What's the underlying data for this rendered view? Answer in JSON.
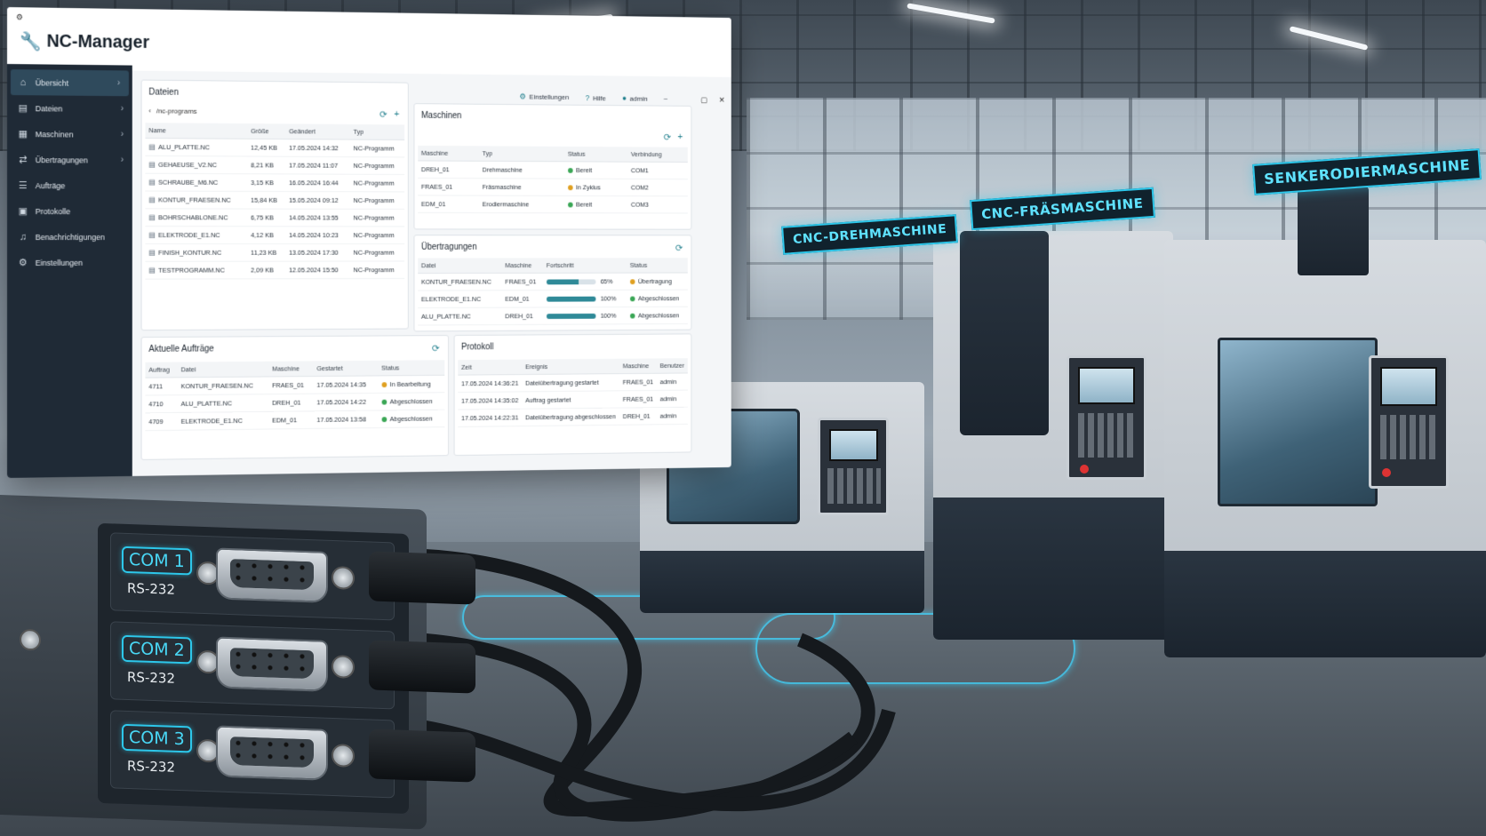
{
  "app": {
    "title": "NC-Manager",
    "accent": "#1e7e8c",
    "sidebar_bg": "#1f2a36"
  },
  "toolbar": {
    "settings": "Einstellungen",
    "help": "Hilfe",
    "user": "admin"
  },
  "sidebar": {
    "items": [
      {
        "label": "Übersicht",
        "icon": "home-icon",
        "active": true,
        "chevron": true
      },
      {
        "label": "Dateien",
        "icon": "file-icon",
        "chevron": true
      },
      {
        "label": "Maschinen",
        "icon": "machine-icon",
        "chevron": true
      },
      {
        "label": "Übertragungen",
        "icon": "transfer-icon",
        "chevron": true
      },
      {
        "label": "Aufträge",
        "icon": "tasks-icon"
      },
      {
        "label": "Protokolle",
        "icon": "log-icon"
      },
      {
        "label": "Benachrichtigungen",
        "icon": "bell-icon"
      },
      {
        "label": "Einstellungen",
        "icon": "gear-icon"
      }
    ]
  },
  "files": {
    "title": "Dateien",
    "path": "/nc-programs",
    "columns": [
      "Name",
      "Größe",
      "Geändert",
      "Typ"
    ],
    "rows": [
      [
        "ALU_PLATTE.NC",
        "12,45 KB",
        "17.05.2024 14:32",
        "NC-Programm"
      ],
      [
        "GEHAEUSE_V2.NC",
        "8,21 KB",
        "17.05.2024 11:07",
        "NC-Programm"
      ],
      [
        "SCHRAUBE_M6.NC",
        "3,15 KB",
        "16.05.2024 16:44",
        "NC-Programm"
      ],
      [
        "KONTUR_FRAESEN.NC",
        "15,84 KB",
        "15.05.2024 09:12",
        "NC-Programm"
      ],
      [
        "BOHRSCHABLONE.NC",
        "6,75 KB",
        "14.05.2024 13:55",
        "NC-Programm"
      ],
      [
        "ELEKTRODE_E1.NC",
        "4,12 KB",
        "14.05.2024 10:23",
        "NC-Programm"
      ],
      [
        "FINISH_KONTUR.NC",
        "11,23 KB",
        "13.05.2024 17:30",
        "NC-Programm"
      ],
      [
        "TESTPROGRAMM.NC",
        "2,09 KB",
        "12.05.2024 15:50",
        "NC-Programm"
      ]
    ]
  },
  "machines": {
    "title": "Maschinen",
    "columns": [
      "Maschine",
      "Typ",
      "Status",
      "Verbindung"
    ],
    "rows": [
      {
        "name": "DREH_01",
        "type": "Drehmaschine",
        "status": "Bereit",
        "color": "#3aa655",
        "conn": "COM1"
      },
      {
        "name": "FRAES_01",
        "type": "Fräsmaschine",
        "status": "In Zyklus",
        "color": "#e0a020",
        "conn": "COM2"
      },
      {
        "name": "EDM_01",
        "type": "Erodiermaschine",
        "status": "Bereit",
        "color": "#3aa655",
        "conn": "COM3"
      }
    ]
  },
  "transfers": {
    "title": "Übertragungen",
    "columns": [
      "Datei",
      "Maschine",
      "Fortschritt",
      "Status"
    ],
    "rows": [
      {
        "file": "KONTUR_FRAESEN.NC",
        "machine": "FRAES_01",
        "progress": 65,
        "pct": "65%",
        "status": "Übertragung",
        "color": "#e0a020"
      },
      {
        "file": "ELEKTRODE_E1.NC",
        "machine": "EDM_01",
        "progress": 100,
        "pct": "100%",
        "status": "Abgeschlossen",
        "color": "#3aa655"
      },
      {
        "file": "ALU_PLATTE.NC",
        "machine": "DREH_01",
        "progress": 100,
        "pct": "100%",
        "status": "Abgeschlossen",
        "color": "#3aa655"
      }
    ]
  },
  "jobs": {
    "title": "Aktuelle Aufträge",
    "columns": [
      "Auftrag",
      "Datei",
      "Maschine",
      "Gestartet",
      "Status"
    ],
    "rows": [
      {
        "id": "4711",
        "file": "KONTUR_FRAESEN.NC",
        "machine": "FRAES_01",
        "started": "17.05.2024 14:35",
        "status": "In Bearbeitung",
        "color": "#e0a020"
      },
      {
        "id": "4710",
        "file": "ALU_PLATTE.NC",
        "machine": "DREH_01",
        "started": "17.05.2024 14:22",
        "status": "Abgeschlossen",
        "color": "#3aa655"
      },
      {
        "id": "4709",
        "file": "ELEKTRODE_E1.NC",
        "machine": "EDM_01",
        "started": "17.05.2024 13:58",
        "status": "Abgeschlossen",
        "color": "#3aa655"
      }
    ]
  },
  "log": {
    "title": "Protokoll",
    "columns": [
      "Zeit",
      "Ereignis",
      "Maschine",
      "Benutzer"
    ],
    "rows": [
      [
        "17.05.2024 14:36:21",
        "Dateiübertragung gestartet",
        "FRAES_01",
        "admin"
      ],
      [
        "17.05.2024 14:35:02",
        "Auftrag gestartet",
        "FRAES_01",
        "admin"
      ],
      [
        "17.05.2024 14:22:31",
        "Dateiübertragung abgeschlossen",
        "DREH_01",
        "admin"
      ]
    ]
  },
  "scene": {
    "labels": [
      "CNC-DREHMASCHINE",
      "CNC-FRÄSMASCHINE",
      "SENKERODIERMASCHINE"
    ],
    "ports": [
      {
        "name": "COM 1",
        "type": "RS-232"
      },
      {
        "name": "COM 2",
        "type": "RS-232"
      },
      {
        "name": "COM 3",
        "type": "RS-232"
      }
    ]
  }
}
